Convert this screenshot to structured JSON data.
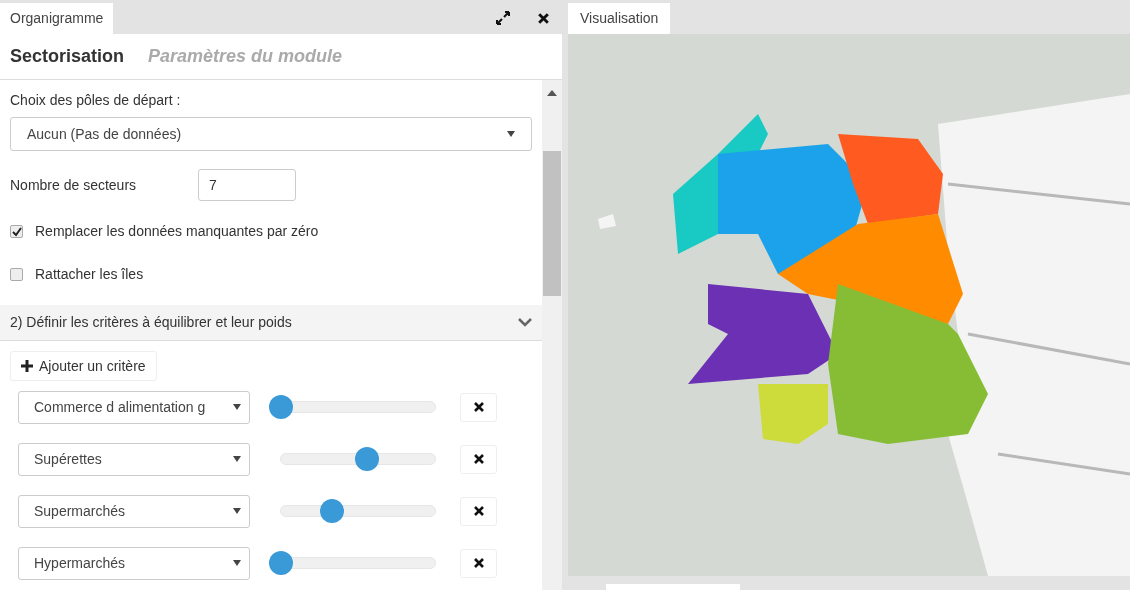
{
  "left_panel": {
    "tab": "Organigramme",
    "heading_tabs": [
      {
        "label": "Sectorisation",
        "selected": true
      },
      {
        "label": "Paramètres du module",
        "selected": false
      }
    ],
    "start_poles": {
      "label": "Choix des pôles de départ :",
      "value": "Aucun (Pas de données)"
    },
    "sector_count": {
      "label": "Nombre de secteurs",
      "value": "7"
    },
    "options": [
      {
        "label": "Remplacer les données manquantes par zéro",
        "checked": true
      },
      {
        "label": "Rattacher les îles",
        "checked": false
      }
    ],
    "section": {
      "title": "2) Définir les critères à équilibrer et leur poids",
      "expanded": true
    },
    "add_button": "Ajouter un critère",
    "criteria": [
      {
        "value": "Commerce d alimentation g",
        "level": 0
      },
      {
        "value": "Supérettes",
        "level": 0.56
      },
      {
        "value": "Supermarchés",
        "level": 0.33
      },
      {
        "value": "Hypermarchés",
        "level": 0
      }
    ]
  },
  "right_panel": {
    "tab": "Visualisation"
  }
}
